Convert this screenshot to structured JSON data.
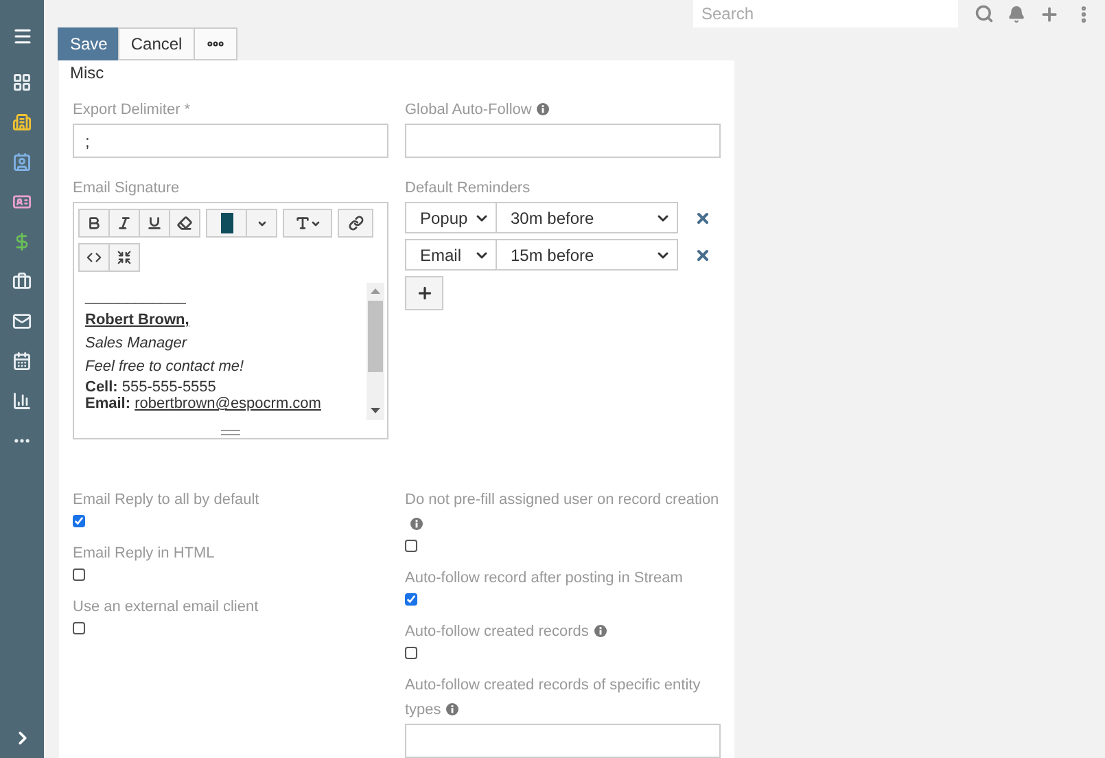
{
  "sidebar": {
    "items": [
      {
        "kind": "dashboard"
      },
      {
        "kind": "building"
      },
      {
        "kind": "contact"
      },
      {
        "kind": "card"
      },
      {
        "kind": "dollar"
      },
      {
        "kind": "briefcase"
      },
      {
        "kind": "mail"
      },
      {
        "kind": "calendar"
      },
      {
        "kind": "chart"
      },
      {
        "kind": "more"
      }
    ]
  },
  "topbar": {
    "search": {
      "placeholder": "Search"
    }
  },
  "actions": {
    "save": "Save",
    "cancel": "Cancel"
  },
  "panel": {
    "title": "Misc",
    "export_delimiter": {
      "label": "Export Delimiter *",
      "value": ";"
    },
    "global_auto_follow": {
      "label": "Global Auto-Follow",
      "info": true
    },
    "email_signature": {
      "label": "Email Signature",
      "lines": [
        {
          "kind": "rule",
          "text": "____________"
        },
        {
          "kind": "name",
          "text": "Robert Brown,"
        },
        {
          "kind": "italic",
          "text": "Sales Manager"
        },
        {
          "kind": "italic",
          "text": "Feel free to contact me!"
        },
        {
          "kind": "labeled",
          "label": "Cell:",
          "text": "555-555-5555"
        },
        {
          "kind": "labeled-link",
          "label": "Email:",
          "text": "robertbrown@espocrm.com"
        }
      ]
    },
    "default_reminders": {
      "label": "Default Reminders",
      "items": [
        {
          "type": "Popup",
          "time": "30m before"
        },
        {
          "type": "Email",
          "time": "15m before"
        }
      ]
    },
    "left_checks": [
      {
        "label": "Email Reply to all by default",
        "checked": true,
        "info": false
      },
      {
        "label": "Email Reply in HTML",
        "checked": false,
        "info": false
      },
      {
        "label": "Use an external email client",
        "checked": false,
        "info": false
      }
    ],
    "right_checks": [
      {
        "kind": "checkbox",
        "label": "Do not pre-fill assigned user on record creation",
        "checked": false,
        "info": true
      },
      {
        "kind": "checkbox",
        "label": "Auto-follow record after posting in Stream",
        "checked": true,
        "info": false
      },
      {
        "kind": "checkbox",
        "label": "Auto-follow created records",
        "checked": false,
        "info": true
      },
      {
        "kind": "field",
        "label": "Auto-follow created records of specific entity types",
        "info": true
      }
    ]
  }
}
